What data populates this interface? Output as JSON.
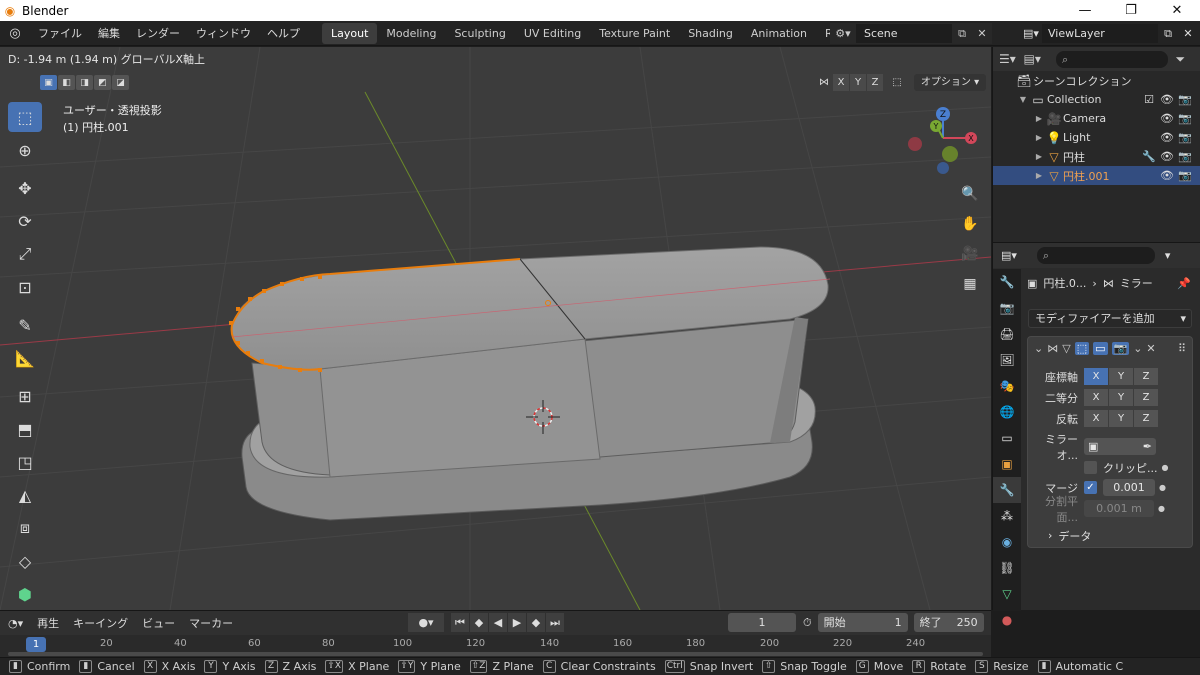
{
  "window": {
    "title": "Blender",
    "buttons": [
      "—",
      "❐",
      "✕"
    ]
  },
  "menu": [
    "ファイル",
    "編集",
    "レンダー",
    "ウィンドウ",
    "ヘルプ"
  ],
  "workspace_tabs": [
    "Layout",
    "Modeling",
    "Sculpting",
    "UV Editing",
    "Texture Paint",
    "Shading",
    "Animation",
    "Rendering"
  ],
  "active_tab": "Layout",
  "scene": "Scene",
  "view_layer": "ViewLayer",
  "viewport": {
    "operation_status": "D: -1.94 m (1.94 m) グローバルX軸上",
    "view_name": "ユーザー・透視投影",
    "object_label": "(1) 円柱.001",
    "mirror_axes": [
      "X",
      "Y",
      "Z"
    ],
    "options_label": "オプション",
    "gizmo_labels": {
      "z": "Z",
      "y": "Y",
      "x": "X"
    },
    "colors": {
      "background": "#3c3c3c",
      "grid": "#474747",
      "x_axis": "#9b3a47",
      "y_axis": "#6b8a2a",
      "selection": "#e87d0d",
      "mesh": "#9a9a9a"
    }
  },
  "outliner": {
    "search_placeholder": "",
    "scene_collection": "シーンコレクション",
    "items": [
      {
        "name": "Collection",
        "icon": "collection-icon"
      },
      {
        "name": "Camera",
        "icon": "camera-icon"
      },
      {
        "name": "Light",
        "icon": "light-icon"
      },
      {
        "name": "円柱",
        "icon": "mesh-icon"
      },
      {
        "name": "円柱.001",
        "icon": "mesh-icon",
        "selected": true
      }
    ]
  },
  "properties": {
    "breadcrumb_object": "円柱.0...",
    "breadcrumb_modifier": "ミラー",
    "add_modifier": "モディファイアーを追加",
    "rows": {
      "axis": "座標軸",
      "bisect": "二等分",
      "flip": "反転",
      "mirror_object": "ミラーオ...",
      "clipping": "クリッピ...",
      "merge": "マージ",
      "merge_value": "0.001",
      "bisect_distance": "分割平面...",
      "bisect_distance_value": "0.001 m",
      "data": "データ"
    },
    "axis_state": {
      "x": true,
      "y": false,
      "z": false
    },
    "merge_checked": true
  },
  "timeline": {
    "menus": [
      "再生",
      "キーイング",
      "ビュー",
      "マーカー"
    ],
    "current_frame": "1",
    "start_label": "開始",
    "start": "1",
    "end_label": "終了",
    "end": "250",
    "ruler_current": "1",
    "ticks": [
      "20",
      "40",
      "60",
      "80",
      "100",
      "120",
      "140",
      "160",
      "180",
      "200",
      "220",
      "240"
    ]
  },
  "statusbar": [
    {
      "key": "",
      "label": "Confirm"
    },
    {
      "key": "",
      "label": "Cancel"
    },
    {
      "key": "X",
      "label": "X Axis"
    },
    {
      "key": "Y",
      "label": "Y Axis"
    },
    {
      "key": "Z",
      "label": "Z Axis"
    },
    {
      "key": "⇧X",
      "label": "X Plane"
    },
    {
      "key": "⇧Y",
      "label": "Y Plane"
    },
    {
      "key": "⇧Z",
      "label": "Z Plane"
    },
    {
      "key": "C",
      "label": "Clear Constraints"
    },
    {
      "key": "Ctrl",
      "label": "Snap Invert"
    },
    {
      "key": "⇧",
      "label": "Snap Toggle"
    },
    {
      "key": "G",
      "label": "Move"
    },
    {
      "key": "R",
      "label": "Rotate"
    },
    {
      "key": "S",
      "label": "Resize"
    },
    {
      "key": "",
      "label": "Automatic C"
    }
  ]
}
